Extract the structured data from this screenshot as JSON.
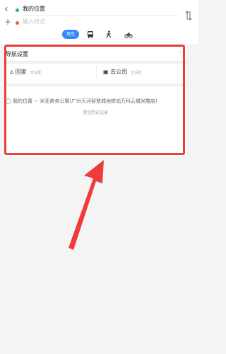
{
  "header": {
    "origin": "我的位置",
    "destination_placeholder": "输入终点",
    "modes": [
      {
        "label": "驾车",
        "icon": "car-icon",
        "active": true
      },
      {
        "label": "",
        "icon": "bus-icon",
        "active": false
      },
      {
        "label": "",
        "icon": "walk-icon",
        "active": false
      },
      {
        "label": "",
        "icon": "bike-icon",
        "active": false
      }
    ]
  },
  "panel": {
    "nav_settings": "导航设置",
    "home_label": "回家",
    "home_sub": "去设置",
    "company_label": "去公司",
    "company_sub": "去设置",
    "history_item": "我的位置 − 米亚商务公寓(广州天河智慧城地铁站万科云城米酷店)",
    "clear_history": "清空历史记录"
  },
  "colors": {
    "accent": "#3688ff",
    "annotation_red": "#ee3b3b"
  }
}
